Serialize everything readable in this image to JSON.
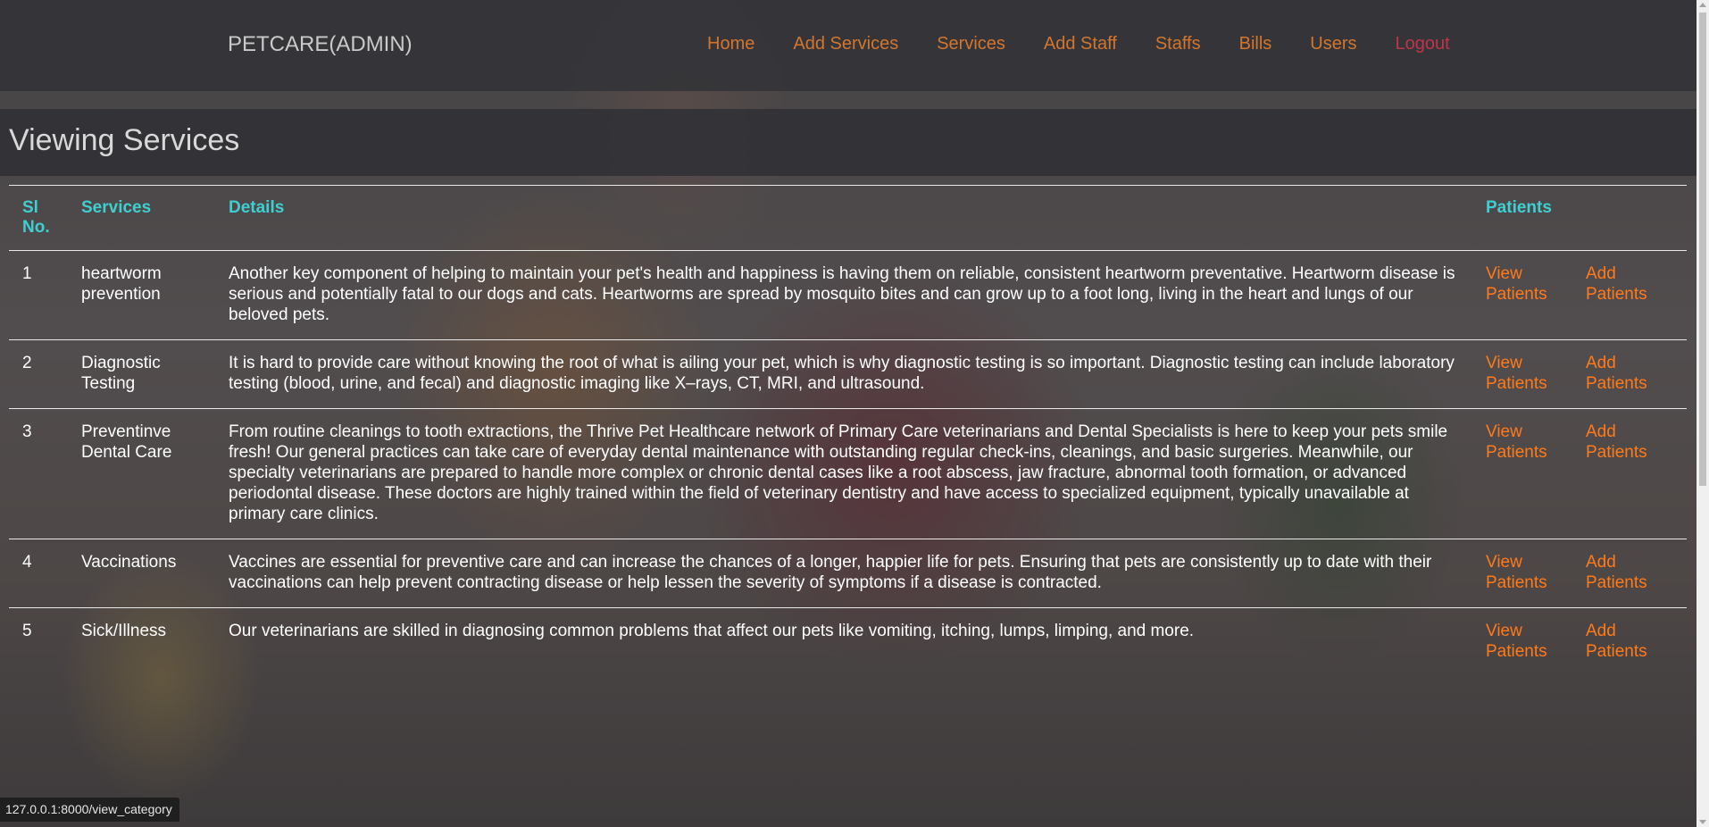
{
  "navbar": {
    "brand": "PETCARE(ADMIN)",
    "links": [
      "Home",
      "Add Services",
      "Services",
      "Add Staff",
      "Staffs",
      "Bills",
      "Users"
    ],
    "logout": "Logout"
  },
  "page_title": "Viewing Services",
  "table": {
    "headers": {
      "si": "Sl No.",
      "services": "Services",
      "details": "Details",
      "patients": "Patients"
    },
    "rows": [
      {
        "si": "1",
        "service": "heartworm prevention",
        "details": "Another key component of helping to maintain your pet's health and happiness is having them on reliable, consistent heartworm preventative. Heartworm disease is serious and potentially fatal to our dogs and cats. Heartworms are spread by mosquito bites and can grow up to a foot long, living in the heart and lungs of our beloved pets.",
        "view": "View Patients",
        "add": "Add Patients"
      },
      {
        "si": "2",
        "service": "Diagnostic Testing",
        "details": "It is hard to provide care without knowing the root of what is ailing your pet, which is why diagnostic testing is so important. Diagnostic testing can include laboratory testing (blood, urine, and fecal) and diagnostic imaging like X–rays, CT, MRI, and ultrasound.",
        "view": "View Patients",
        "add": "Add Patients"
      },
      {
        "si": "3",
        "service": "Preventinve Dental Care",
        "details": "From routine cleanings to tooth extractions, the Thrive Pet Healthcare network of Primary Care veterinarians and Dental Specialists is here to keep your pets smile fresh! Our general practices can take care of everyday dental maintenance with outstanding regular check-ins, cleanings, and basic surgeries. Meanwhile, our specialty veterinarians are prepared to handle more complex or chronic dental cases like a root abscess, jaw fracture, abnormal tooth formation, or advanced periodontal disease. These doctors are highly trained within the field of veterinary dentistry and have access to specialized equipment, typically unavailable at primary care clinics.",
        "view": "View Patients",
        "add": "Add Patients"
      },
      {
        "si": "4",
        "service": "Vaccinations",
        "details": "Vaccines are essential for preventive care and can increase the chances of a longer, happier life for pets. Ensuring that pets are consistently up to date with their vaccinations can help prevent contracting disease or help lessen the severity of symptoms if a disease is contracted.",
        "view": "View Patients",
        "add": "Add Patients"
      },
      {
        "si": "5",
        "service": "Sick/Illness",
        "details": "Our veterinarians are skilled in diagnosing common problems that affect our pets like vomiting, itching, lumps, limping, and more.",
        "view": "View Patients",
        "add": "Add Patients"
      }
    ]
  },
  "status_bar": "127.0.0.1:8000/view_category",
  "colors": {
    "nav_link": "#d2762e",
    "logout": "#c0344a",
    "header_text": "#3ecfd1",
    "action_link": "#ff7a1a"
  }
}
